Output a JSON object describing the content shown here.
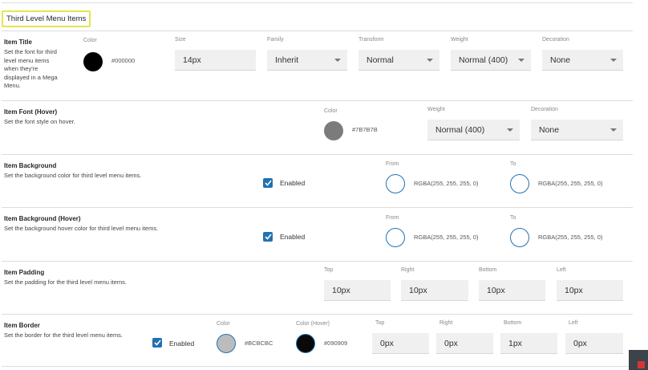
{
  "section_title": "Third Level Menu Items",
  "item_title": {
    "title": "Item Title",
    "desc_lines": [
      "Set the font for third",
      "level menu items",
      "when they're",
      "displayed in a Mega",
      "Menu."
    ],
    "color_label": "Color",
    "color_hex": "#000000",
    "color_value": "#000000",
    "size_label": "Size",
    "size_value": "14px",
    "family_label": "Family",
    "family_value": "Inherit",
    "transform_label": "Transform",
    "transform_value": "Normal",
    "weight_label": "Weight",
    "weight_value": "Normal (400)",
    "decoration_label": "Decoration",
    "decoration_value": "None"
  },
  "item_font_hover": {
    "title": "Item Font (Hover)",
    "desc": "Set the font style on hover.",
    "color_label": "Color",
    "color_hex": "#7B7B7B",
    "color_value": "#7b7b7b",
    "weight_label": "Weight",
    "weight_value": "Normal (400)",
    "decoration_label": "Decoration",
    "decoration_value": "None"
  },
  "item_background": {
    "title": "Item Background",
    "desc": "Set the background color for third level menu items.",
    "enabled_label": "Enabled",
    "from_label": "From",
    "from_value": "RGBA(255, 255, 255, 0)",
    "to_label": "To",
    "to_value": "RGBA(255, 255, 255, 0)"
  },
  "item_background_hover": {
    "title": "Item Background (Hover)",
    "desc": "Set the background hover color for third level menu items.",
    "enabled_label": "Enabled",
    "from_label": "From",
    "from_value": "RGBA(255, 255, 255, 0)",
    "to_label": "To",
    "to_value": "RGBA(255, 255, 255, 0)"
  },
  "item_padding": {
    "title": "Item Padding",
    "desc": "Set the padding for the third level menu items.",
    "top_label": "Top",
    "top_value": "10px",
    "right_label": "Right",
    "right_value": "10px",
    "bottom_label": "Bottom",
    "bottom_value": "10px",
    "left_label": "Left",
    "left_value": "10px"
  },
  "item_border": {
    "title": "Item Border",
    "desc": "Set the border for the third level menu items.",
    "enabled_label": "Enabled",
    "color_label": "Color",
    "color_hex": "#BCBCBC",
    "color_value": "#bcbcbc",
    "color_hover_label": "Color (Hover)",
    "color_hover_hex": "#090909",
    "color_hover_value": "#090909",
    "top_label": "Top",
    "top_value": "0px",
    "right_label": "Right",
    "right_value": "0px",
    "bottom_label": "Bottom",
    "bottom_value": "1px",
    "left_label": "Left",
    "left_value": "0px"
  },
  "colors": {
    "accent": "#2271b1",
    "highlight": "#e3e553",
    "swatch_ring": "#2271b1"
  }
}
